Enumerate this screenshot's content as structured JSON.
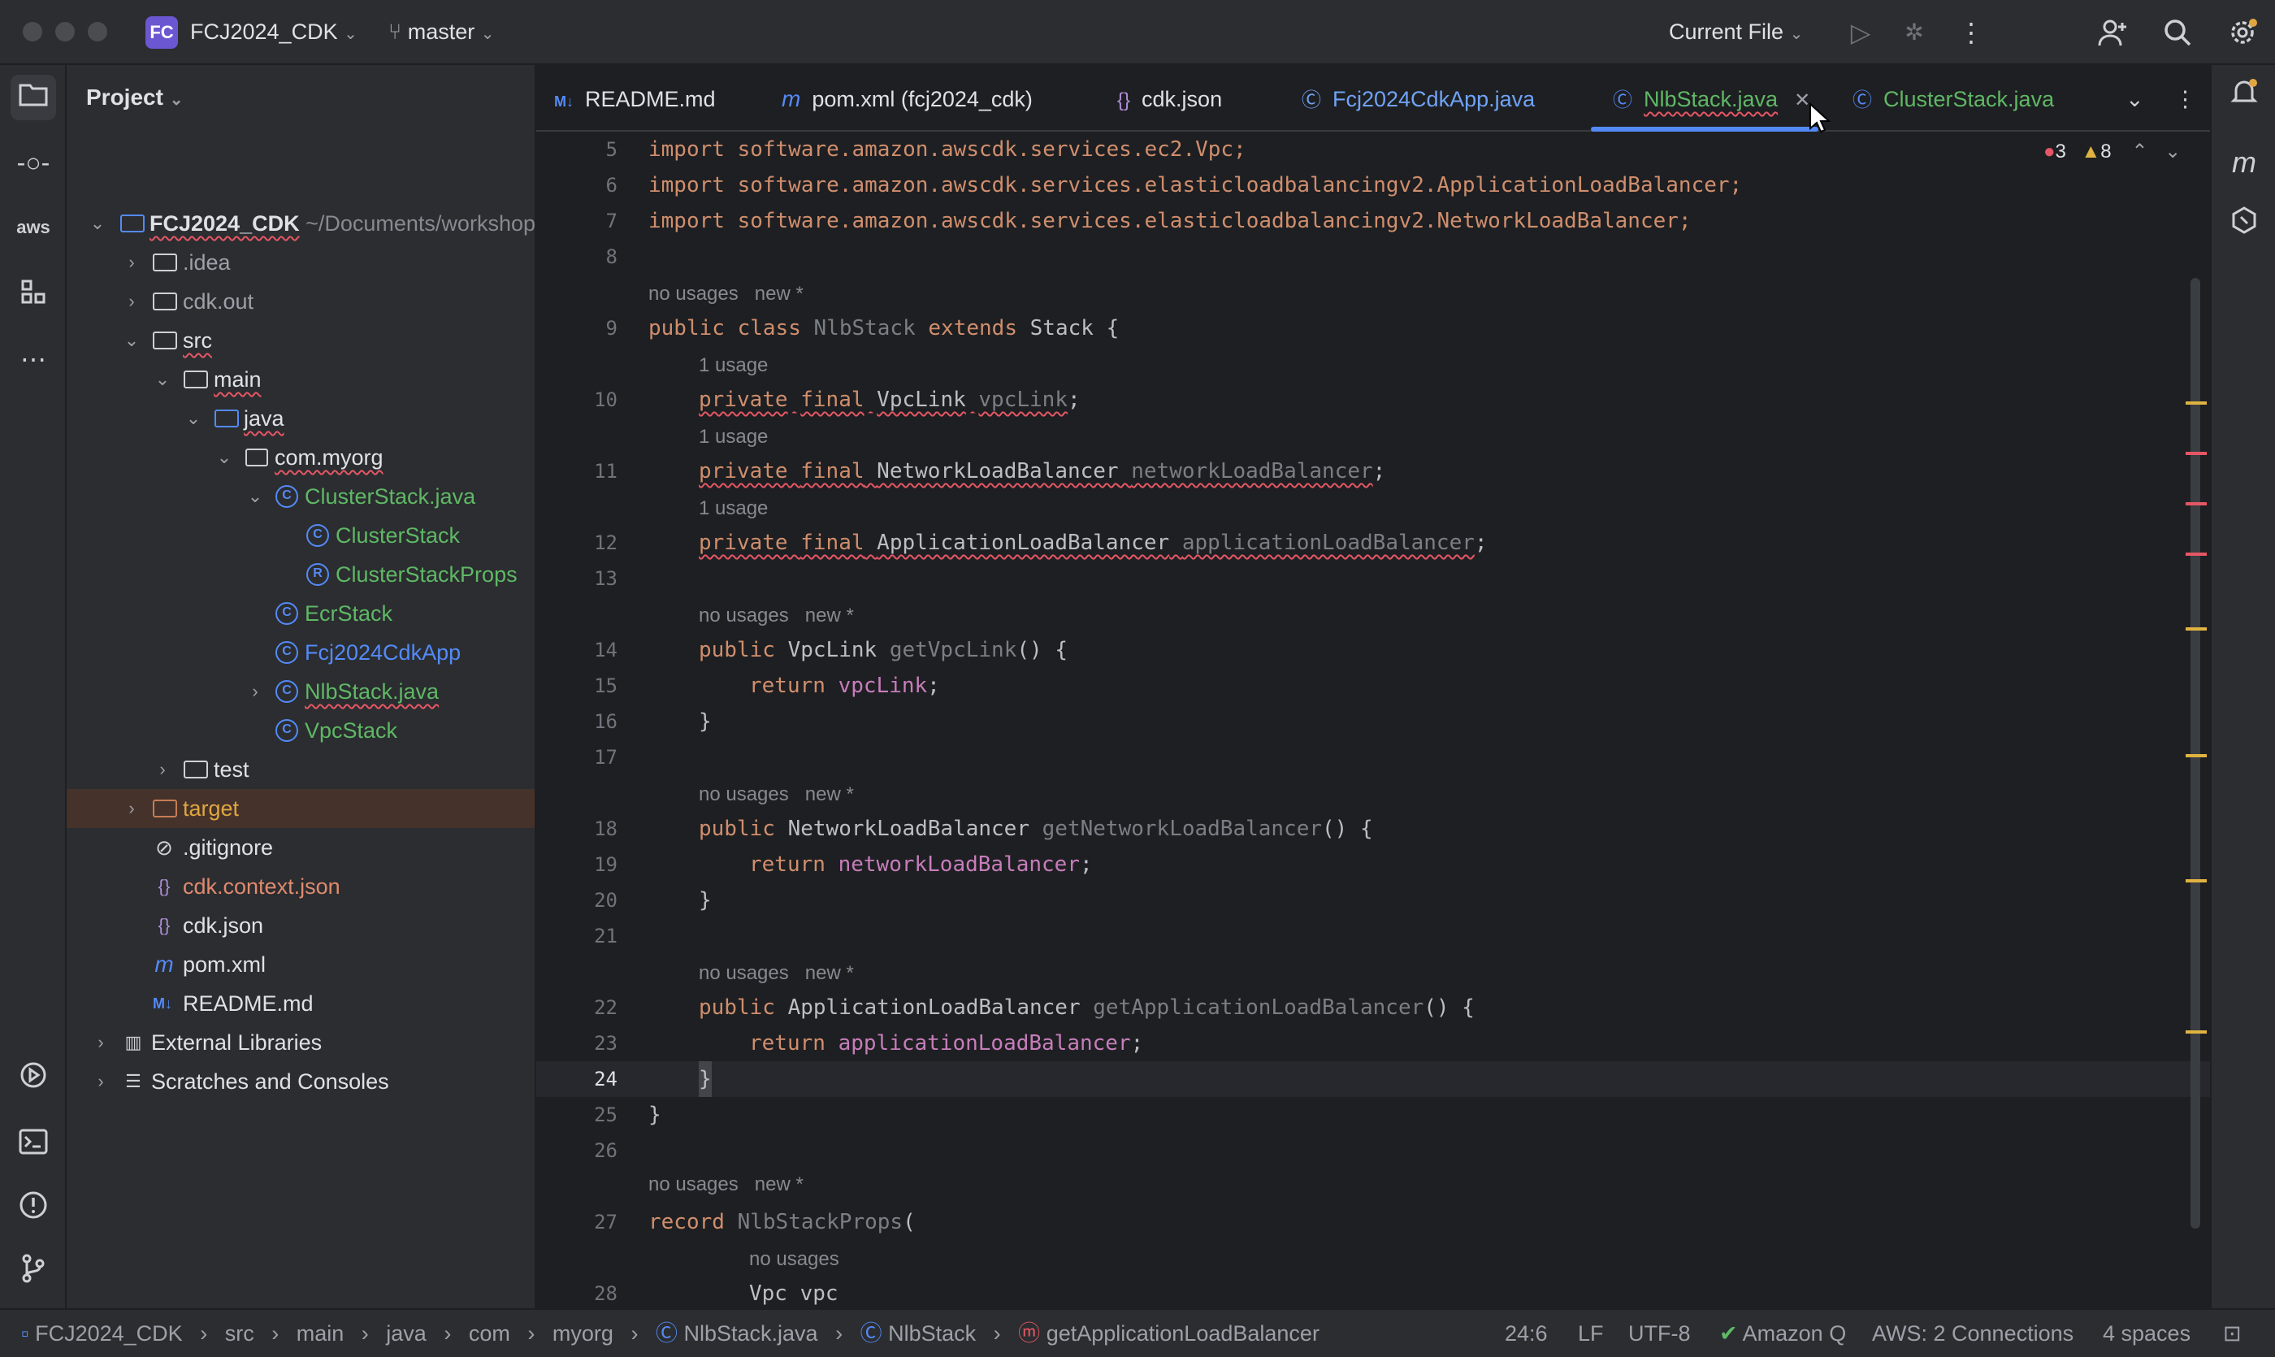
{
  "titlebar": {
    "project_badge": "FC",
    "project_name": "FCJ2024_CDK",
    "branch": "master",
    "run_config": "Current File",
    "icons": [
      "run-icon",
      "debug-icon",
      "more-vert-icon",
      "add-user-icon",
      "search-icon",
      "settings-icon"
    ]
  },
  "project_panel": {
    "title": "Project",
    "root_name": "FCJ2024_CDK",
    "root_path": "~/Documents/workshop",
    "items": [
      {
        "label": "FCJ2024_CDK",
        "kind": "module"
      },
      {
        "label": ".idea",
        "kind": "folder"
      },
      {
        "label": "cdk.out",
        "kind": "folder"
      },
      {
        "label": "src",
        "kind": "folder"
      },
      {
        "label": "main",
        "kind": "folder"
      },
      {
        "label": "java",
        "kind": "folder-blue"
      },
      {
        "label": "com.myorg",
        "kind": "package"
      },
      {
        "label": "ClusterStack.java",
        "kind": "class"
      },
      {
        "label": "ClusterStack",
        "kind": "class"
      },
      {
        "label": "ClusterStackProps",
        "kind": "record"
      },
      {
        "label": "EcrStack",
        "kind": "class"
      },
      {
        "label": "Fcj2024CdkApp",
        "kind": "class"
      },
      {
        "label": "NlbStack.java",
        "kind": "class"
      },
      {
        "label": "VpcStack",
        "kind": "class"
      },
      {
        "label": "test",
        "kind": "folder"
      },
      {
        "label": "target",
        "kind": "folder-orange"
      },
      {
        "label": ".gitignore",
        "kind": "ignore"
      },
      {
        "label": "cdk.context.json",
        "kind": "json"
      },
      {
        "label": "cdk.json",
        "kind": "json"
      },
      {
        "label": "pom.xml",
        "kind": "maven"
      },
      {
        "label": "README.md",
        "kind": "markdown"
      },
      {
        "label": "External Libraries",
        "kind": "library"
      },
      {
        "label": "Scratches and Consoles",
        "kind": "scratch"
      }
    ]
  },
  "tabs": [
    {
      "label": "README.md",
      "icon": "M↓"
    },
    {
      "label": "pom.xml (fcj2024_cdk)",
      "icon": "m"
    },
    {
      "label": "cdk.json",
      "icon": "{}"
    },
    {
      "label": "Fcj2024CdkApp.java",
      "icon": "©"
    },
    {
      "label": "NlbStack.java",
      "icon": "©"
    },
    {
      "label": "ClusterStack.java",
      "icon": "©"
    }
  ],
  "inspections": {
    "errors": "3",
    "warnings": "8"
  },
  "editor": {
    "line_numbers": [
      "5",
      "6",
      "7",
      "8",
      "9",
      "10",
      "11",
      "12",
      "13",
      "14",
      "15",
      "16",
      "17",
      "18",
      "19",
      "20",
      "21",
      "22",
      "23",
      "24",
      "25",
      "26",
      "27",
      "28"
    ],
    "hints": {
      "no_usages": "no usages",
      "new": "new *",
      "one_usage": "1 usage"
    },
    "code": {
      "l5": "import software.amazon.awscdk.services.ec2.Vpc;",
      "l6": "import software.amazon.awscdk.services.elasticloadbalancingv2.ApplicationLoadBalancer;",
      "l7": "import software.amazon.awscdk.services.elasticloadbalancingv2.NetworkLoadBalancer;",
      "kw_public": "public",
      "kw_class": "class",
      "kw_extends": "extends",
      "kw_private": "private",
      "kw_final": "final",
      "kw_return": "return",
      "kw_record": "record",
      "class_name": "NlbStack",
      "stack": "Stack",
      "open_brace": " {",
      "close_brace": "}",
      "type_vpclink": "VpcLink",
      "type_nlb": "NetworkLoadBalancer",
      "type_alb": "ApplicationLoadBalancer",
      "f_vpclink": "vpcLink",
      "f_nlb": "networkLoadBalancer",
      "f_alb": "applicationLoadBalancer",
      "m_vpclink": "getVpcLink",
      "m_nlb": "getNetworkLoadBalancer",
      "m_alb": "getApplicationLoadBalancer",
      "parens": "() {",
      "semi": ";",
      "record_name": "NlbStackProps",
      "record_open": "(",
      "vpc_param": "Vpc vpc"
    }
  },
  "breadcrumb": [
    "FCJ2024_CDK",
    "src",
    "main",
    "java",
    "com",
    "myorg",
    "NlbStack.java",
    "NlbStack",
    "getApplicationLoadBalancer"
  ],
  "status": {
    "position": "24:6",
    "line_sep": "LF",
    "encoding": "UTF-8",
    "amazon_q": "Amazon Q",
    "aws": "AWS: 2 Connections",
    "indent": "4 spaces"
  },
  "colors": {
    "accent": "#548af7",
    "keyword": "#cf8e6d",
    "field": "#c77dbb",
    "method": "#56a8f5",
    "error": "#e55765",
    "warning": "#e0b341"
  }
}
